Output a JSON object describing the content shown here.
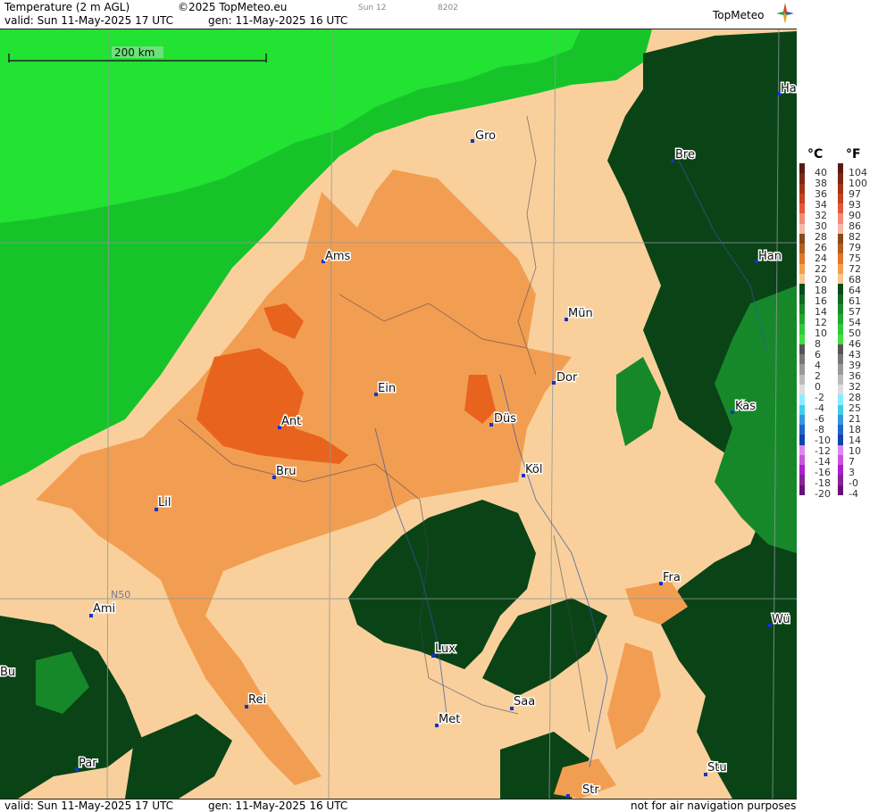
{
  "header": {
    "title": "Temperature (2 m AGL)",
    "copyright": "©2025 TopMeteo.eu",
    "day_code": "Sun 12",
    "code": "8202",
    "valid": "valid:  Sun  11-May-2025  17 UTC",
    "generated": "gen: 11-May-2025 16 UTC",
    "logo": "TopMeteo"
  },
  "footer": {
    "valid": "valid:  Sun  11-May-2025  17 UTC",
    "generated": "gen: 11-May-2025 16 UTC",
    "disclaimer": "not for air navigation purposes"
  },
  "map": {
    "scale_label": "200 km",
    "lat_label": "N50",
    "cities": [
      "Gro",
      "Bre",
      "Ha",
      "Ams",
      "Han",
      "Mün",
      "Ein",
      "Dor",
      "Ant",
      "Düs",
      "Kas",
      "Bru",
      "Köl",
      "Lil",
      "Fra",
      "Ami",
      "Wü",
      "Lux",
      "Rei",
      "Saa",
      "Met",
      "Bu",
      "Par",
      "Stu",
      "Str"
    ]
  },
  "legend": {
    "celsius_unit": "°C",
    "fahrenheit_unit": "°F",
    "celsius": [
      "40",
      "38",
      "36",
      "34",
      "32",
      "30",
      "28",
      "26",
      "24",
      "22",
      "20",
      "18",
      "16",
      "14",
      "12",
      "10",
      "8",
      "6",
      "4",
      "2",
      "0",
      "-2",
      "-4",
      "-6",
      "-8",
      "-10",
      "-12",
      "-14",
      "-16",
      "-18",
      "-20"
    ],
    "fahrenheit": [
      "104",
      "100",
      "97",
      "93",
      "90",
      "86",
      "82",
      "79",
      "75",
      "72",
      "68",
      "64",
      "61",
      "57",
      "54",
      "50",
      "46",
      "43",
      "39",
      "36",
      "32",
      "28",
      "25",
      "21",
      "18",
      "14",
      "10",
      "7",
      "3",
      "-0",
      "-4"
    ],
    "colors": [
      "#5a1a10",
      "#7a2a12",
      "#a03418",
      "#c4421e",
      "#e05a3a",
      "#f08c78",
      "#f6b8a8",
      "#8a4a1c",
      "#b06020",
      "#e07828",
      "#f2a050",
      "#f7c890",
      "#0a4a1a",
      "#0f6a22",
      "#1a8a2a",
      "#22a832",
      "#2fc83a",
      "#44dd44",
      "#555",
      "#777",
      "#999",
      "#bbb",
      "#ddd",
      "#88eeff",
      "#44ccee",
      "#3399dd",
      "#2266cc",
      "#1144aa",
      "#dd88ee",
      "#cc55dd",
      "#aa22cc",
      "#882299",
      "#661177"
    ]
  },
  "colors": {
    "sea_bright": "#22e232",
    "sea_mid": "#16c42a",
    "land_dark": "#0a4316",
    "land_mid": "#17882a",
    "temp_16_18": "#f9d09c",
    "temp_18_20": "#f29e52",
    "temp_20_22": "#e8641e"
  }
}
